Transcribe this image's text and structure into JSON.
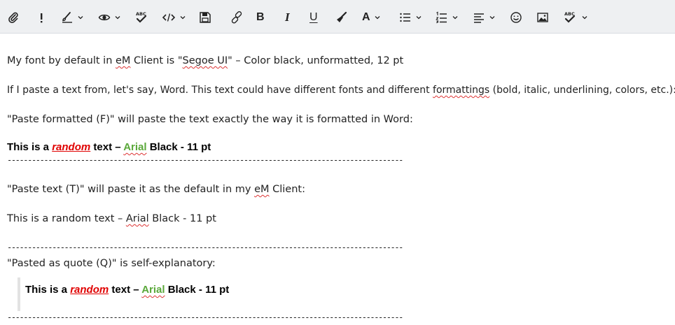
{
  "toolbar": {
    "icons": [
      "paperclip-icon",
      "importance-icon",
      "format-brush-icon",
      "eye-icon",
      "spellcheck-icon",
      "code-icon",
      "save-icon",
      "link-icon",
      "bold-icon",
      "italic-icon",
      "underline-icon",
      "clear-format-icon",
      "font-color-icon",
      "bullet-list-icon",
      "numbered-list-icon",
      "align-icon",
      "emoji-icon",
      "image-icon",
      "spellcheck-icon"
    ],
    "bold": "B",
    "italic": "I",
    "underline": "U",
    "font_color": "A",
    "abc": "ABC"
  },
  "body": {
    "line1_a": "My font by default in ",
    "line1_em": "eM",
    "line1_b": " Client is \"",
    "line1_segoe": "Segoe UI",
    "line1_c": "\" –  Color black, unformatted, 12 pt",
    "line2_a": "If I paste a text from, let's say, Word. This text could have different fonts and different ",
    "line2_fmt": "formattings",
    "line2_b": " (bold, italic, underlining, colors, etc.):",
    "line3": "\"Paste formatted (F)\" will paste the text exactly the way it is formatted in Word:",
    "sample_a": "This is a ",
    "sample_random": "random",
    "sample_b": " text – ",
    "sample_arial": "Arial",
    "sample_c": " Black - 11 pt",
    "dashes": "-------------------------------------------------------------------------------------------------",
    "line5_a": "\"Paste text (T)\" will paste it as the default in my ",
    "line5_em": "eM",
    "line5_b": " Client:",
    "plain_a": "This is a random text – ",
    "plain_arial": "Arial",
    "plain_b": " Black - 11 pt",
    "line7": "\"Pasted as quote (Q)\" is self-explanatory:"
  }
}
